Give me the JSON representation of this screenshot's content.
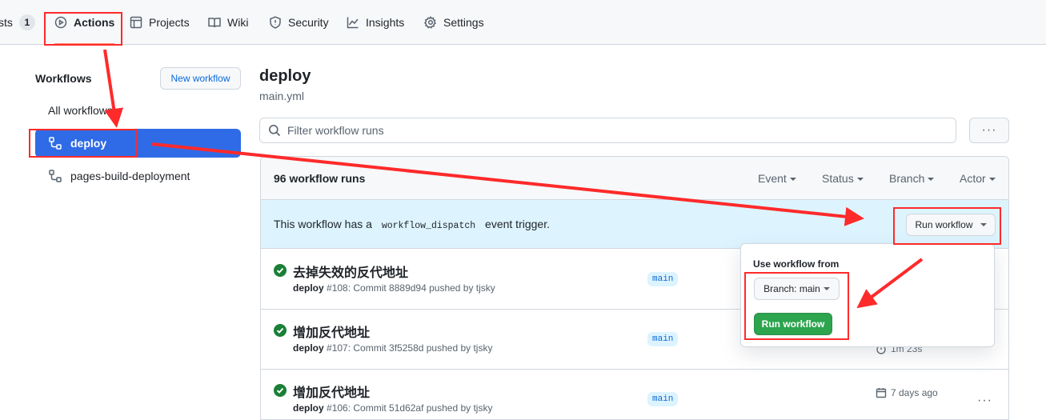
{
  "nav": {
    "tabs": [
      {
        "label": "sts",
        "counter": "1"
      },
      {
        "label": "Actions"
      },
      {
        "label": "Projects"
      },
      {
        "label": "Wiki"
      },
      {
        "label": "Security"
      },
      {
        "label": "Insights"
      },
      {
        "label": "Settings"
      }
    ]
  },
  "sidebar": {
    "title": "Workflows",
    "new_workflow": "New workflow",
    "all_workflows": "All workflows",
    "items": [
      {
        "label": "deploy"
      },
      {
        "label": "pages-build-deployment"
      }
    ]
  },
  "main": {
    "title": "deploy",
    "subtitle": "main.yml",
    "search_placeholder": "Filter workflow runs",
    "more": "···",
    "runs_count": "96 workflow runs",
    "filters": [
      "Event",
      "Status",
      "Branch",
      "Actor"
    ],
    "dispatch": {
      "prefix": "This workflow has a",
      "code": "workflow_dispatch",
      "suffix": "event trigger.",
      "button": "Run workflow"
    },
    "runs": [
      {
        "title": "去掉失效的反代地址",
        "workflow": "deploy",
        "meta": "#108: Commit 8889d94 pushed by tjsky",
        "branch": "main"
      },
      {
        "title": "增加反代地址",
        "workflow": "deploy",
        "meta": "#107: Commit 3f5258d pushed by tjsky",
        "branch": "main",
        "duration": "1m 23s"
      },
      {
        "title": "增加反代地址",
        "workflow": "deploy",
        "meta": "#106: Commit 51d62af pushed by tjsky",
        "branch": "main",
        "date": "7 days ago"
      }
    ]
  },
  "dropdown": {
    "label": "Use workflow from",
    "branch_button": "Branch: main",
    "run_button": "Run workflow"
  },
  "colors": {
    "accent_red": "#ff2a2a",
    "selected_blue": "#2f6be6",
    "success_green": "#2da44e"
  }
}
